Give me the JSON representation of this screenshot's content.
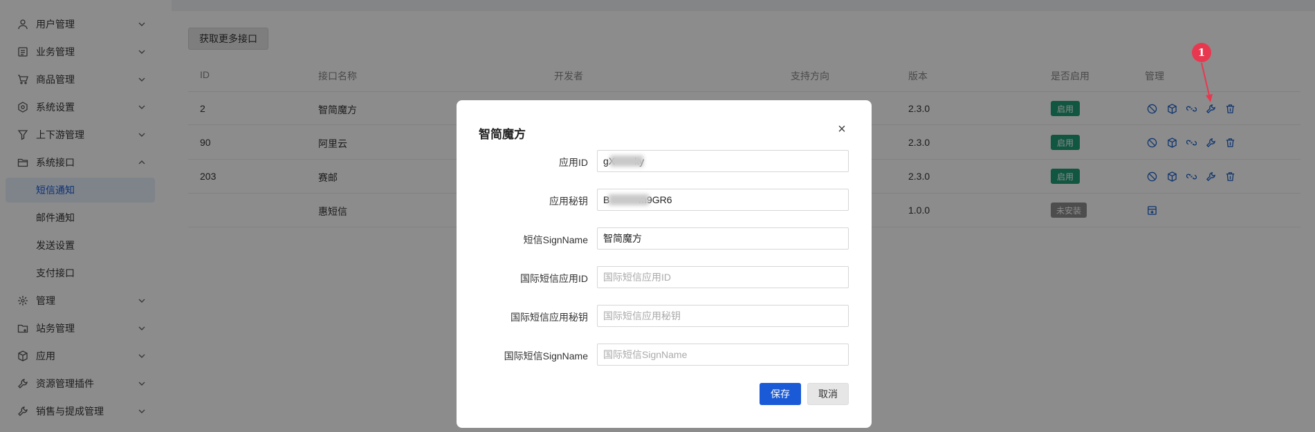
{
  "sidebar": {
    "items": [
      {
        "label": "用户管理",
        "icon": "user-icon"
      },
      {
        "label": "业务管理",
        "icon": "list-icon"
      },
      {
        "label": "商品管理",
        "icon": "cart-icon"
      },
      {
        "label": "系统设置",
        "icon": "settings-icon"
      },
      {
        "label": "上下游管理",
        "icon": "filter-icon"
      },
      {
        "label": "系统接口",
        "icon": "folder-icon"
      }
    ],
    "sub_items": [
      {
        "label": "短信通知"
      },
      {
        "label": "邮件通知"
      },
      {
        "label": "发送设置"
      },
      {
        "label": "支付接口"
      }
    ],
    "items_after": [
      {
        "label": "管理",
        "icon": "cog-icon"
      },
      {
        "label": "站务管理",
        "icon": "folder-plus-icon"
      },
      {
        "label": "应用",
        "icon": "box-icon"
      },
      {
        "label": "资源管理插件",
        "icon": "wrench-icon"
      },
      {
        "label": "销售与提成管理",
        "icon": "wrench-icon"
      }
    ]
  },
  "toolbar": {
    "more_label": "获取更多接口"
  },
  "table": {
    "headers": {
      "id": "ID",
      "name": "接口名称",
      "developer": "开发者",
      "direction": "支持方向",
      "version": "版本",
      "enabled": "是否启用",
      "manage": "管理"
    },
    "rows": [
      {
        "id": "2",
        "name": "智简魔方",
        "version": "2.3.0",
        "status": "启用"
      },
      {
        "id": "90",
        "name": "阿里云",
        "version": "2.3.0",
        "status": "启用"
      },
      {
        "id": "203",
        "name": "赛邮",
        "version": "2.3.0",
        "status": "启用"
      },
      {
        "id": "",
        "name": "惠短信",
        "version": "1.0.0",
        "status": "未安装"
      }
    ]
  },
  "annotation": {
    "number": "1"
  },
  "modal": {
    "title": "智简魔方",
    "close": "×",
    "fields": [
      {
        "label": "应用ID",
        "value": "gX  ky",
        "placeholder": ""
      },
      {
        "label": "应用秘钥",
        "value": "B   m9GR6",
        "placeholder": ""
      },
      {
        "label": "短信SignName",
        "value": "智简魔方",
        "placeholder": ""
      },
      {
        "label": "国际短信应用ID",
        "value": "",
        "placeholder": "国际短信应用ID"
      },
      {
        "label": "国际短信应用秘钥",
        "value": "",
        "placeholder": "国际短信应用秘钥"
      },
      {
        "label": "国际短信SignName",
        "value": "",
        "placeholder": "国际短信SignName"
      }
    ],
    "save_label": "保存",
    "cancel_label": "取消"
  },
  "colors": {
    "primary": "#1a5ad7",
    "enabled_badge": "#1f9d75",
    "uninstalled_badge": "#8c8c8c",
    "annotation": "#e8384f"
  }
}
